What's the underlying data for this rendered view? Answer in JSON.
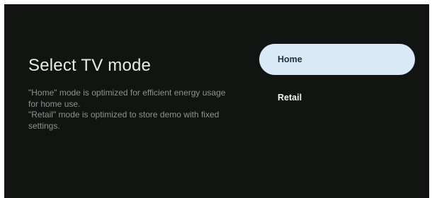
{
  "screen": {
    "title": "Select TV mode",
    "description_lines": [
      "\"Home\" mode is optimized for efficient energy usage for home use.",
      "\"Retail\" mode is optimized to store demo with fixed settings."
    ]
  },
  "options": [
    {
      "label": "Home",
      "selected": true
    },
    {
      "label": "Retail",
      "selected": false
    }
  ],
  "colors": {
    "background": "#121412",
    "selected_pill": "#d9e9f7",
    "title_text": "#e8eae8",
    "description_text": "#8e928f"
  }
}
